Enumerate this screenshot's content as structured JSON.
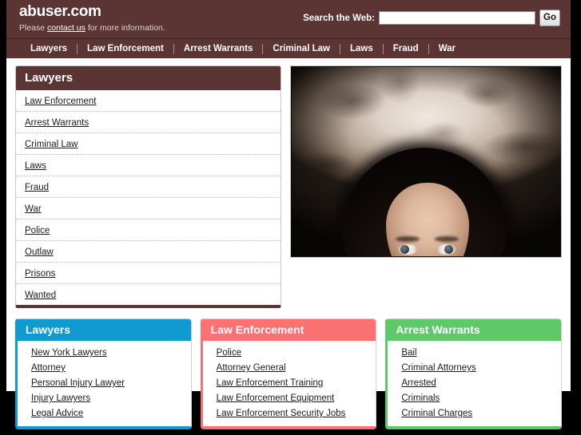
{
  "header": {
    "site_title": "abuser.com",
    "tagline_before": "Please ",
    "tagline_link": "contact us",
    "tagline_after": " for more information.",
    "search_label": "Search the Web:",
    "search_value": "",
    "search_placeholder": "",
    "go_label": "Go"
  },
  "nav": {
    "items": [
      {
        "label": "Lawyers"
      },
      {
        "label": "Law Enforcement"
      },
      {
        "label": "Arrest Warrants"
      },
      {
        "label": "Criminal Law"
      },
      {
        "label": "Laws"
      },
      {
        "label": "Fraud"
      },
      {
        "label": "War"
      }
    ]
  },
  "feature_panel": {
    "title": "Lawyers",
    "links": [
      {
        "label": "Law Enforcement"
      },
      {
        "label": "Arrest Warrants"
      },
      {
        "label": "Criminal Law"
      },
      {
        "label": "Laws"
      },
      {
        "label": "Fraud"
      },
      {
        "label": "War"
      },
      {
        "label": "Police"
      },
      {
        "label": "Outlaw"
      },
      {
        "label": "Prisons"
      },
      {
        "label": "Wanted"
      }
    ]
  },
  "feature_image": {
    "alt": "woman-looking-up-photo"
  },
  "boxes": [
    {
      "title": "Lawyers",
      "color": "#0f9bd0",
      "links": [
        {
          "label": "New York Lawyers"
        },
        {
          "label": "Attorney"
        },
        {
          "label": "Personal Injury Lawyer"
        },
        {
          "label": "Injury Lawyers"
        },
        {
          "label": "Legal Advice"
        }
      ]
    },
    {
      "title": "Law Enforcement",
      "color": "#fa7272",
      "links": [
        {
          "label": "Police"
        },
        {
          "label": "Attorney General"
        },
        {
          "label": "Law Enforcement Training"
        },
        {
          "label": "Law Enforcement Equipment"
        },
        {
          "label": "Law Enforcement Security Jobs"
        }
      ]
    },
    {
      "title": "Arrest Warrants",
      "color": "#5fc96a",
      "links": [
        {
          "label": "Bail"
        },
        {
          "label": "Criminal Attorneys"
        },
        {
          "label": "Arrested"
        },
        {
          "label": "Criminals"
        },
        {
          "label": "Criminal Charges"
        }
      ]
    }
  ],
  "theme": {
    "brand_maroon": "#5b3434",
    "page_background": "#ffffff",
    "outer_background": "#000000"
  }
}
